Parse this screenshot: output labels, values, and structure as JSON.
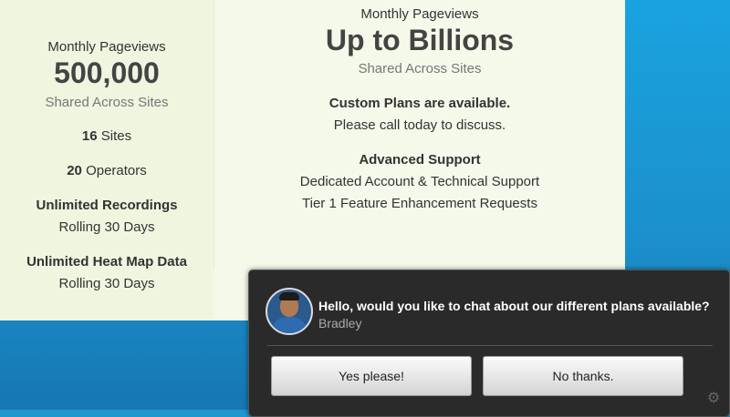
{
  "left_plan": {
    "pageviews_label": "Monthly Pageviews",
    "pageviews_value": "500,000",
    "shared": "Shared Across Sites",
    "sites_count": "16",
    "sites_label": "Sites",
    "operators_count": "20",
    "operators_label": "Operators",
    "recordings_title": "Unlimited Recordings",
    "recordings_sub": "Rolling 30 Days",
    "heatmap_title": "Unlimited Heat Map Data",
    "heatmap_sub": "Rolling 30 Days"
  },
  "right_plan": {
    "pageviews_label": "Monthly Pageviews",
    "pageviews_value": "Up to Billions",
    "shared": "Shared Across Sites",
    "custom_title": "Custom Plans are available.",
    "custom_sub": "Please call today to discuss.",
    "support_title": "Advanced Support",
    "support_line1": "Dedicated Account & Technical Support",
    "support_line2": "Tier 1 Feature Enhancement Requests"
  },
  "chat": {
    "message": "Hello, would you like to chat about our different plans available?",
    "agent_name": "Bradley",
    "yes_label": "Yes please!",
    "no_label": "No thanks."
  },
  "colors": {
    "background_blue": "#1b8fcb",
    "card_green": "#eef6e0",
    "chat_dark": "#2a2a2a"
  }
}
